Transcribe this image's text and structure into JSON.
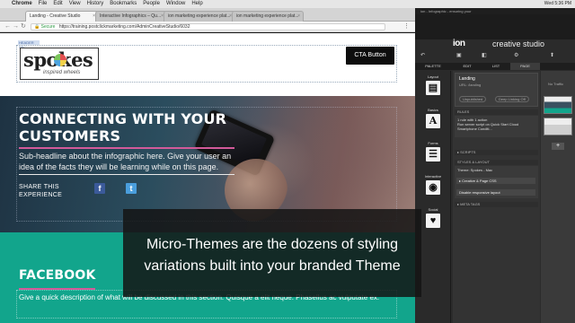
{
  "menubar": {
    "apple": "",
    "items": [
      "Chrome",
      "File",
      "Edit",
      "View",
      "History",
      "Bookmarks",
      "People",
      "Window",
      "Help"
    ],
    "right": "Wed 5:36 PM"
  },
  "tabs": [
    {
      "label": "Landing - Creative Studio"
    },
    {
      "label": "Interactive Infographics – Qu..."
    },
    {
      "label": "ion marketing experience plat..."
    },
    {
      "label": "ion marketing experience plat..."
    }
  ],
  "address": {
    "secure": "Secure",
    "url": "https://training.postclickmarketing.com/AdminCreativeStudio/6032"
  },
  "page": {
    "header_tag": "HEADER SEC",
    "logo": {
      "word": "spokes",
      "sub": "inspired wheels"
    },
    "cta_label": "CTA Button",
    "hero": {
      "title": "CONNECTING WITH YOUR CUSTOMERS",
      "sub": "Sub-headline about the infographic here. Give your user an idea of the facts they will be learning while on this page.",
      "share": "SHARE THIS EXPERIENCE",
      "fb": "f",
      "tw": "t"
    },
    "teal": {
      "title": "FACEBOOK",
      "body": "Give a quick description of what will be discussed in this section. Quisque a elit neque. Phasellus ac vulputate ex."
    }
  },
  "caption": "Micro-Themes are the dozens of styling variations built into your branded Theme",
  "editor": {
    "window_title": "ion - Infographic - ensuring your",
    "logo": "ion",
    "title": "creative studio",
    "tabs": [
      "PALETTE",
      "EDIT",
      "LIST",
      "PAGE"
    ],
    "palette": [
      {
        "label": "Layout",
        "icon": "▤"
      },
      {
        "label": "Basics",
        "icon": "A"
      },
      {
        "label": "Forms",
        "icon": "☰"
      },
      {
        "label": "Interactive",
        "icon": "◉"
      },
      {
        "label": "Social",
        "icon": "♥"
      }
    ],
    "props": {
      "name": "Landing",
      "url": "URL: /landing",
      "pill1": "Unpublished",
      "pill2": "Deep Linking Off",
      "rules_head": "RULES",
      "rules_body": "1 rule with 1 action",
      "rules_action": "Run server script on Quick Start Cloud Smartphone Conditi...",
      "scripts_head": "▸ SCRIPTS",
      "styles_head": "STYLES & LAYOUT",
      "theme": "Theme: Spokes - Mac",
      "css_btn": "▸ Creative & Page CSS",
      "resp_btn": "Disable responsive layout",
      "meta_head": "▸ META TAGS"
    },
    "thumbs": {
      "notraffic": "No Traffic",
      "plus": "+"
    }
  },
  "colors": {
    "teal": "#12a58c",
    "pink": "#d25a9a",
    "cta": "#0d0d0d",
    "editor_bg": "#2b2b2b"
  }
}
